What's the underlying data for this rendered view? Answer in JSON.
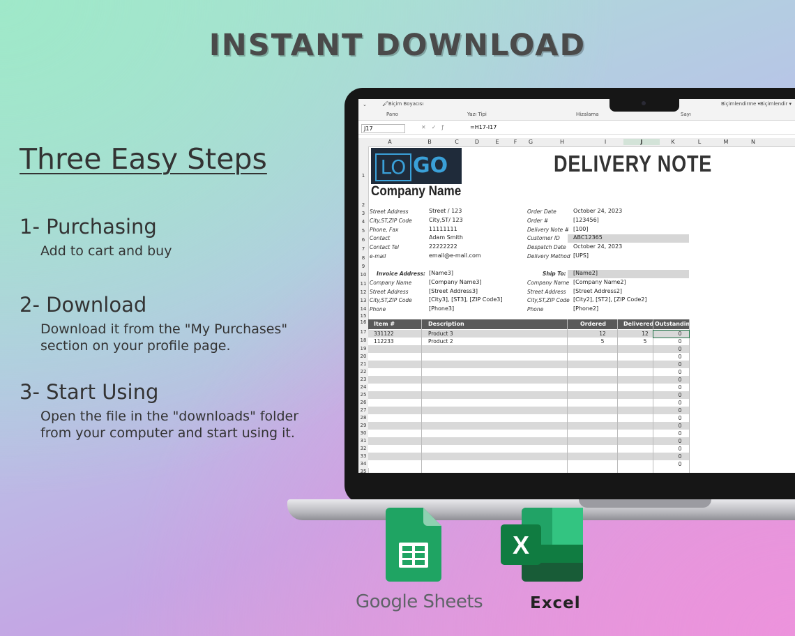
{
  "headline": "INSTANT DOWNLOAD",
  "steps_title": "Three Easy Steps",
  "steps": [
    {
      "title": "1- Purchasing",
      "desc": "Add to cart and buy"
    },
    {
      "title": "2- Download",
      "desc_line1": "Download it from the \"My Purchases\"",
      "desc_line2": "section on your profile page."
    },
    {
      "title": "3- Start Using",
      "desc_line1": "Open the file in the \"downloads\" folder",
      "desc_line2": "from your computer and start using it."
    }
  ],
  "spreadsheet": {
    "ribbon": {
      "format_painter": "Biçim Boyacısı",
      "clipboard": "Pano",
      "font": "Yazı Tipi",
      "alignment": "Hizalama",
      "number": "Sayı",
      "formatting": "Biçimlendirme ▾",
      "format": "Biçimlendir ▾"
    },
    "name_box": "J17",
    "formula": "=H17-I17",
    "columns": [
      "A",
      "B",
      "C",
      "D",
      "E",
      "F",
      "G",
      "H",
      "I",
      "J",
      "K",
      "L",
      "M",
      "N"
    ],
    "row_numbers": [
      "1",
      "2",
      "3",
      "4",
      "5",
      "6",
      "7",
      "8",
      "9",
      "10",
      "11",
      "12",
      "13",
      "14",
      "15",
      "16",
      "17",
      "18",
      "19",
      "20",
      "21",
      "22",
      "23",
      "24",
      "25",
      "26",
      "27",
      "28",
      "29",
      "30",
      "31",
      "32",
      "33",
      "34",
      "35"
    ],
    "logo_lo": "LO",
    "logo_go": "GO",
    "company_name": "Company Name",
    "doc_title": "DELIVERY NOTE",
    "left_info": [
      {
        "label": "Street Address",
        "value": "Street / 123"
      },
      {
        "label": "City,ST,ZIP Code",
        "value": "City,ST/ 123"
      },
      {
        "label": "Phone, Fax",
        "value": "11111111"
      },
      {
        "label": "Contact",
        "value": "Adam Smith"
      },
      {
        "label": "Contact Tel",
        "value": "22222222"
      },
      {
        "label": "e-mail",
        "value": "email@e-mail.com"
      }
    ],
    "right_info": [
      {
        "label": "Order Date",
        "value": "October 24, 2023"
      },
      {
        "label": "Order #",
        "value": "[123456]"
      },
      {
        "label": "Delivery Note #",
        "value": "[100]"
      },
      {
        "label": "Customer ID",
        "value": "ABC12365"
      },
      {
        "label": "Despatch Date",
        "value": "October 24, 2023"
      },
      {
        "label": "Delivery Method",
        "value": "[UPS]"
      }
    ],
    "invoice_label": "Invoice Address:",
    "invoice": [
      {
        "label": "",
        "value": "[Name3]"
      },
      {
        "label": "Company Name",
        "value": "[Company Name3]"
      },
      {
        "label": "Street Address",
        "value": "[Street Address3]"
      },
      {
        "label": "City,ST,ZIP Code",
        "value": "[City3], [ST3], [ZIP Code3]"
      },
      {
        "label": "Phone",
        "value": "[Phone3]"
      }
    ],
    "ship_label": "Ship To:",
    "ship": [
      {
        "label": "",
        "value": "[Name2]"
      },
      {
        "label": "Company Name",
        "value": "[Company Name2]"
      },
      {
        "label": "Street Address",
        "value": "[Street Address2]"
      },
      {
        "label": "City,ST,ZIP Code",
        "value": "[City2], [ST2], [ZIP Code2]"
      },
      {
        "label": "Phone",
        "value": "[Phone2]"
      }
    ],
    "table_headers": {
      "item": "Item #",
      "description": "Description",
      "ordered": "Ordered",
      "delivered": "Delivered",
      "outstanding": "Outstanding"
    },
    "items": [
      {
        "item": "331122",
        "description": "Product 3",
        "ordered": "12",
        "delivered": "12",
        "outstanding": "0"
      },
      {
        "item": "112233",
        "description": "Product 2",
        "ordered": "5",
        "delivered": "5",
        "outstanding": "0"
      }
    ],
    "empty_outstanding": "0"
  },
  "apps": {
    "sheets_label": "Google Sheets",
    "excel_label": "Excel",
    "excel_letter": "X"
  },
  "colors": {
    "sheets_green": "#1fa463",
    "excel_green": "#1d6f42",
    "header_gray": "#595959"
  }
}
